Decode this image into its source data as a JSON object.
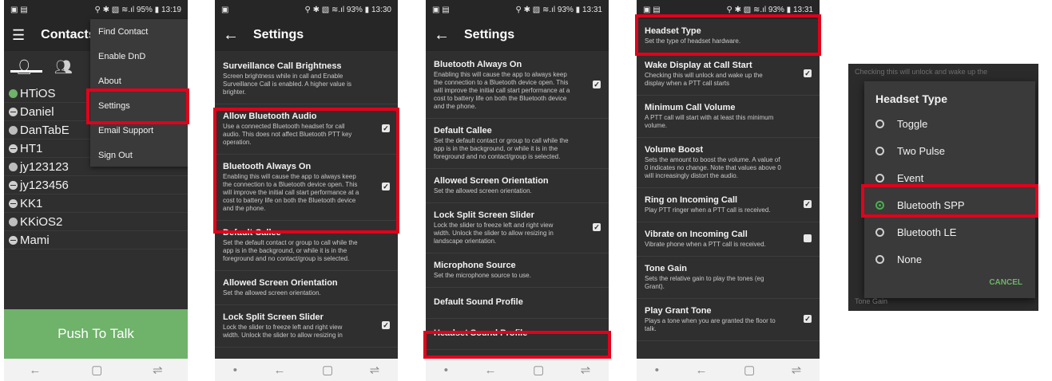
{
  "phone1": {
    "status_left": "▣ ▤",
    "status_right": "⚲ ✱ ▧ ≋.ıl 95% ▮ 13:19",
    "title": "Contacts",
    "menu_icon": "hamburger-icon",
    "contacts": [
      {
        "name": "HTiOS",
        "color": "#6fb26a",
        "icon": "dot"
      },
      {
        "name": "Daniel",
        "color": "#cfcfcf",
        "icon": "minus"
      },
      {
        "name": "DanTabE",
        "color": "#bdbdbd",
        "icon": "dot"
      },
      {
        "name": "HT1",
        "color": "#cfcfcf",
        "icon": "minus"
      },
      {
        "name": "jy123123",
        "color": "#bdbdbd",
        "icon": "dot"
      },
      {
        "name": "jy123456",
        "color": "#cfcfcf",
        "icon": "minus"
      },
      {
        "name": "KK1",
        "color": "#cfcfcf",
        "icon": "minus"
      },
      {
        "name": "KKiOS2",
        "color": "#bdbdbd",
        "icon": "dot"
      },
      {
        "name": "Mami",
        "color": "#cfcfcf",
        "icon": "minus"
      }
    ],
    "menu": [
      "Find Contact",
      "Enable DnD",
      "About",
      "Settings",
      "Email Support",
      "Sign Out"
    ],
    "ptt": "Push To Talk"
  },
  "phone2": {
    "status_right": "⚲ ✱ ▧ ≋.ıl 93% ▮ 13:30",
    "title": "Settings",
    "items": [
      {
        "t": "Surveillance Call Brightness",
        "s": "Screen brightness while in call and Enable Surveillance Call is enabled. A higher value is brighter.",
        "check": false
      },
      {
        "t": "Allow Bluetooth Audio",
        "s": "Use a connected Bluetooth headset for call audio. This does not affect Bluetooth PTT key operation.",
        "check": true
      },
      {
        "t": "Bluetooth Always On",
        "s": "Enabling this will cause the app to always keep the connection to a Bluetooth device open. This will improve the initial call start performance at a cost to battery life on both the Bluetooth device and the phone.",
        "check": true
      },
      {
        "t": "Default Callee",
        "s": "Set the default contact or group to call while the app is in the background, or while it is in the foreground and no contact/group is selected.",
        "check": false
      },
      {
        "t": "Allowed Screen Orientation",
        "s": "Set the allowed screen orientation.",
        "check": false
      },
      {
        "t": "Lock Split Screen Slider",
        "s": "Lock the slider to freeze left and right view width. Unlock the slider to allow resizing in",
        "check": true
      }
    ]
  },
  "phone3": {
    "status_right": "⚲ ✱ ▧ ≋.ıl 93% ▮ 13:31",
    "title": "Settings",
    "items": [
      {
        "t": "Bluetooth Always On",
        "s": "Enabling this will cause the app to always keep the connection to a Bluetooth device open. This will improve the initial call start performance at a cost to battery life on both the Bluetooth device and the phone.",
        "check": true
      },
      {
        "t": "Default Callee",
        "s": "Set the default contact or group to call while the app is in the background, or while it is in the foreground and no contact/group is selected.",
        "check": false
      },
      {
        "t": "Allowed Screen Orientation",
        "s": "Set the allowed screen orientation.",
        "check": false
      },
      {
        "t": "Lock Split Screen Slider",
        "s": "Lock the slider to freeze left and right view width. Unlock the slider to allow resizing in landscape orientation.",
        "check": true
      },
      {
        "t": "Microphone Source",
        "s": "Set the microphone source to use.",
        "check": false
      },
      {
        "t": "Default Sound Profile",
        "s": "",
        "check": false
      },
      {
        "t": "Headset Sound Profile",
        "s": "",
        "check": false
      }
    ]
  },
  "phone4": {
    "status_right": "⚲ ✱ ▧ ≋.ıl 93% ▮ 13:31",
    "items": [
      {
        "t": "Headset Type",
        "s": "Set the type of headset hardware.",
        "check": false
      },
      {
        "t": "Wake Display at Call Start",
        "s": "Checking this will unlock and wake up the display when a PTT call starts",
        "check": true
      },
      {
        "t": "Minimum Call Volume",
        "s": "A PTT call will start with at least this minimum volume.",
        "check": false
      },
      {
        "t": "Volume Boost",
        "s": "Sets the amount to boost the volume. A value of 0 indicates no change. Note that values above 0 will increasingly distort the audio.",
        "check": false
      },
      {
        "t": "Ring on Incoming Call",
        "s": "Play PTT ringer when a PTT call is received.",
        "check": true
      },
      {
        "t": "Vibrate on Incoming Call",
        "s": "Vibrate phone when a PTT call is received.",
        "check": false
      },
      {
        "t": "Tone Gain",
        "s": "Sets the relative gain to play the tones (eg Grant).",
        "check": false
      },
      {
        "t": "Play Grant Tone",
        "s": "Plays a tone when you are granted the floor to talk.",
        "check": true
      }
    ]
  },
  "dialog": {
    "bg_top": "Checking this will unlock and wake up the",
    "bg_bottom": "Tone Gain",
    "title": "Headset Type",
    "options": [
      "Toggle",
      "Two Pulse",
      "Event",
      "Bluetooth SPP",
      "Bluetooth LE",
      "None"
    ],
    "selected": "Bluetooth SPP",
    "cancel": "CANCEL"
  },
  "nav": {
    "back": "←",
    "home": "▢",
    "recent": "⇌",
    "dot": "•"
  },
  "accent": "#6fb26a",
  "highlight": "#e3001b"
}
